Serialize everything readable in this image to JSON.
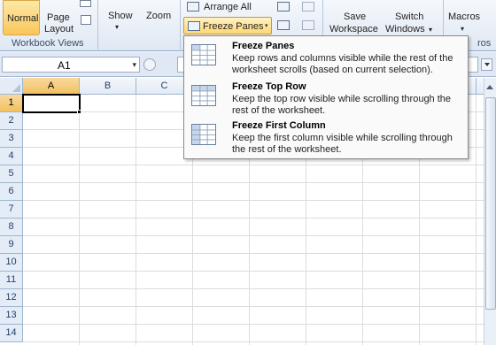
{
  "ribbon": {
    "normal_label": "Normal",
    "page_layout_line1": "Page",
    "page_layout_line2": "Layout",
    "group_workbook_views": "Workbook Views",
    "show_label": "Show",
    "zoom_label": "Zoom",
    "arrange_all_label": "Arrange All",
    "freeze_panes_label": "Freeze Panes",
    "save_workspace_line1": "Save",
    "save_workspace_line2": "Workspace",
    "switch_windows_line1": "Switch",
    "switch_windows_line2": "Windows",
    "macros_label": "Macros",
    "macros_group_partial": "ros",
    "caret": "▾"
  },
  "formula_bar": {
    "name_box_value": "A1",
    "name_box_caret": "▾"
  },
  "grid": {
    "columns": [
      "A",
      "B",
      "C"
    ],
    "rows": [
      "1",
      "2",
      "3",
      "4",
      "5",
      "6",
      "7",
      "8",
      "9",
      "10",
      "11",
      "12",
      "13",
      "14"
    ],
    "active_cell": "A1"
  },
  "menu": {
    "items": [
      {
        "title": "Freeze Panes",
        "description": "Keep rows and columns visible while the rest of the worksheet scrolls (based on current selection)."
      },
      {
        "title": "Freeze Top Row",
        "description": "Keep the top row visible while scrolling through the rest of the worksheet."
      },
      {
        "title": "Freeze First Column",
        "description": "Keep the first column visible while scrolling through the rest of the worksheet."
      }
    ]
  },
  "colors": {
    "selected_header": "#f1c15f",
    "ribbon_bg": "#dfe8f3",
    "gridline": "#dadcdd"
  }
}
